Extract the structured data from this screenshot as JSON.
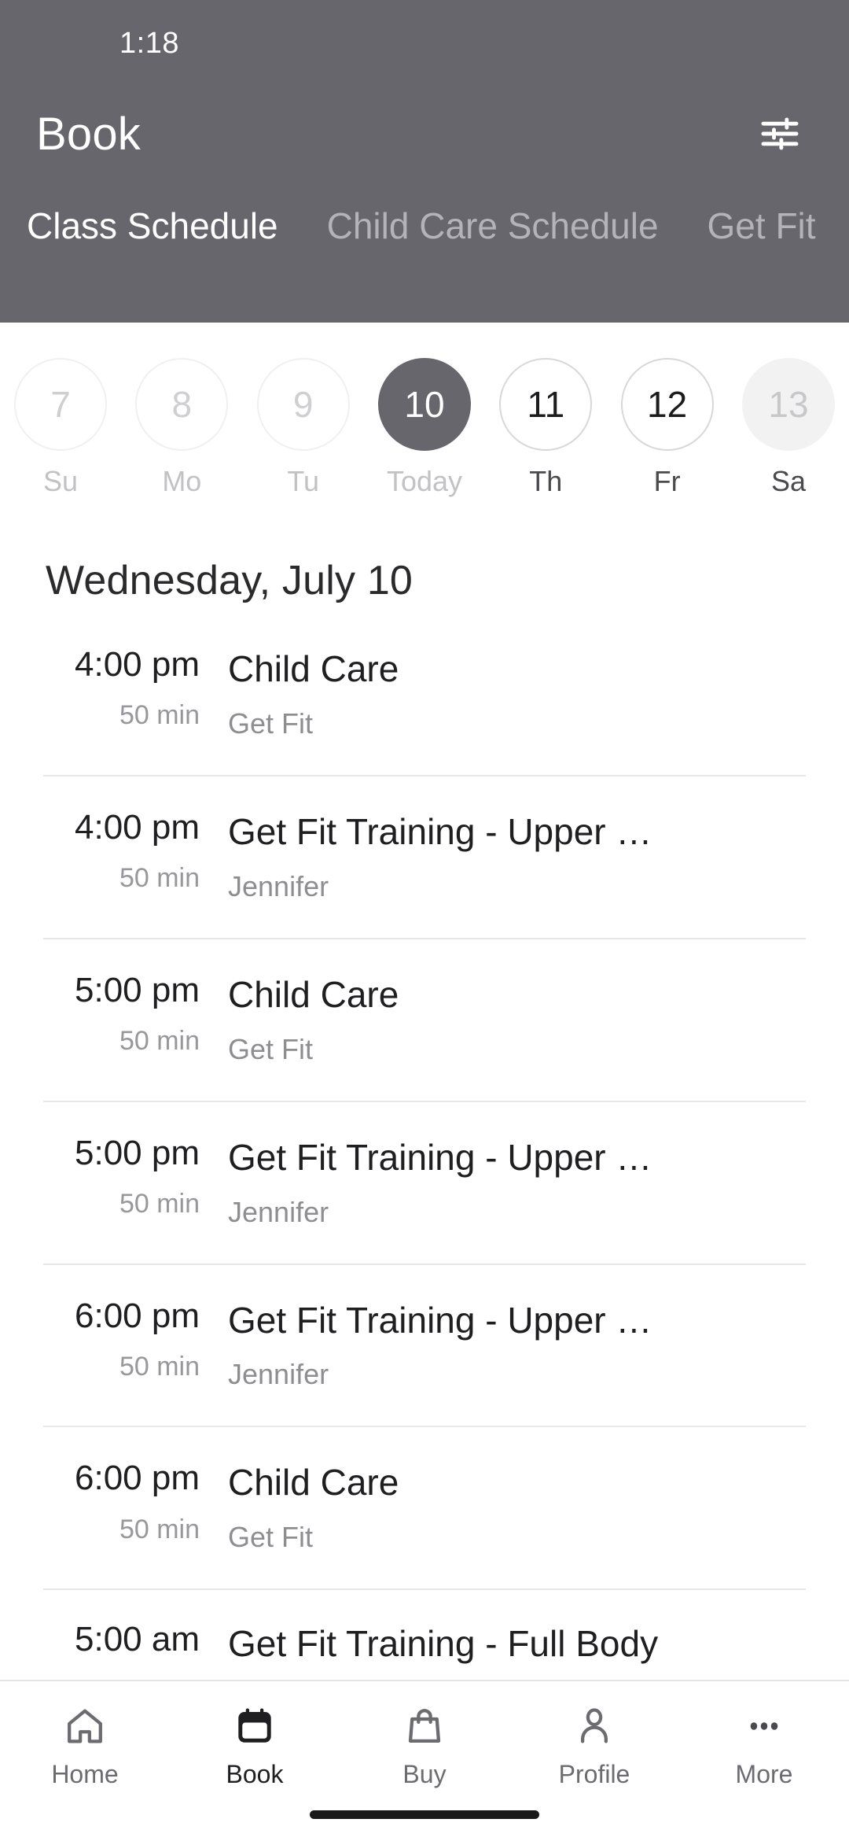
{
  "status_bar": {
    "time": "1:18"
  },
  "header": {
    "title": "Book",
    "filter_icon": "sliders-filter-icon",
    "background_color": "#67666c",
    "tabs": [
      {
        "label": "Class Schedule",
        "active": true
      },
      {
        "label": "Child Care Schedule",
        "active": false
      },
      {
        "label": "Get Fit",
        "active": false
      }
    ]
  },
  "date_strip": {
    "days": [
      {
        "num": "7",
        "label": "Su",
        "state": "past"
      },
      {
        "num": "8",
        "label": "Mo",
        "state": "past"
      },
      {
        "num": "9",
        "label": "Tu",
        "state": "past"
      },
      {
        "num": "10",
        "label": "Today",
        "state": "today"
      },
      {
        "num": "11",
        "label": "Th",
        "state": "avail"
      },
      {
        "num": "12",
        "label": "Fr",
        "state": "avail"
      },
      {
        "num": "13",
        "label": "Sa",
        "state": "muted"
      }
    ]
  },
  "schedule": {
    "date_heading": "Wednesday, July 10",
    "items": [
      {
        "time": "4:00 pm",
        "duration": "50 min",
        "title": "Child Care",
        "subtitle": "Get Fit"
      },
      {
        "time": "4:00 pm",
        "duration": "50 min",
        "title": "Get Fit Training - Upper …",
        "subtitle": "Jennifer"
      },
      {
        "time": "5:00 pm",
        "duration": "50 min",
        "title": "Child Care",
        "subtitle": "Get Fit"
      },
      {
        "time": "5:00 pm",
        "duration": "50 min",
        "title": "Get Fit Training - Upper …",
        "subtitle": "Jennifer"
      },
      {
        "time": "6:00 pm",
        "duration": "50 min",
        "title": "Get Fit Training - Upper …",
        "subtitle": "Jennifer"
      },
      {
        "time": "6:00 pm",
        "duration": "50 min",
        "title": "Child Care",
        "subtitle": "Get Fit"
      },
      {
        "time": "5:00 am",
        "duration": "",
        "title": "Get Fit Training - Full Body",
        "subtitle": ""
      }
    ]
  },
  "bottom_nav": {
    "items": [
      {
        "label": "Home",
        "icon": "home-icon",
        "active": false
      },
      {
        "label": "Book",
        "icon": "calendar-icon",
        "active": true
      },
      {
        "label": "Buy",
        "icon": "bag-icon",
        "active": false
      },
      {
        "label": "Profile",
        "icon": "person-icon",
        "active": false
      },
      {
        "label": "More",
        "icon": "ellipsis-icon",
        "active": false
      }
    ]
  }
}
